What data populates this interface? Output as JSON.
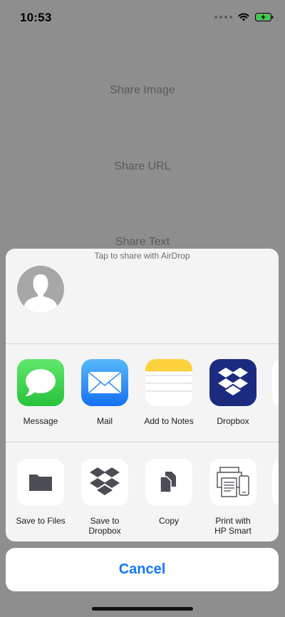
{
  "status_bar": {
    "time": "10:53",
    "battery": "charging"
  },
  "background": {
    "buttons": [
      "Share Image",
      "Share URL",
      "Share Text"
    ]
  },
  "share_sheet": {
    "airdrop_hint": "Tap to share with AirDrop",
    "apps": [
      {
        "label": "Message",
        "icon": "messages-icon"
      },
      {
        "label": "Mail",
        "icon": "mail-icon"
      },
      {
        "label": "Add to Notes",
        "icon": "notes-icon"
      },
      {
        "label": "Dropbox",
        "icon": "dropbox-icon"
      }
    ],
    "actions": [
      {
        "label": "Save to Files",
        "icon": "folder-icon"
      },
      {
        "label": "Save to\nDropbox",
        "icon": "dropbox-icon"
      },
      {
        "label": "Copy",
        "icon": "copy-icon"
      },
      {
        "label": "Print with\nHP Smart",
        "icon": "printer-icon"
      }
    ]
  },
  "cancel_label": "Cancel",
  "colors": {
    "accent": "#1476fb",
    "dropbox": "#1b2b80",
    "messages": "#34c759",
    "mail": "#1e8ef7",
    "notes": "#fcd23c"
  }
}
